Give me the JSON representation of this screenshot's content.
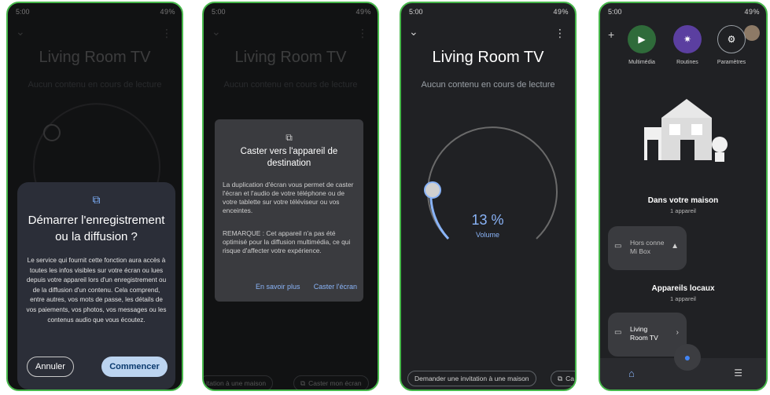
{
  "status": {
    "time": "5:00",
    "icons_left": "⋮ ⁝ ⌚",
    "battery": "49%",
    "signal": "✕ ≋ .ıl .ıl"
  },
  "device_title": "Living Room TV",
  "no_content": "Aucun contenu en cours de lecture",
  "icons": {
    "chevron": "⌄",
    "more": "⋮",
    "cast": "⧉",
    "plus": "+",
    "home": "⌂",
    "list": "☰",
    "mic": "🎤"
  },
  "screen1": {
    "dialog_title_line1": "Démarrer l'enregistrement",
    "dialog_title_line2": "ou la diffusion ?",
    "dialog_body": "Le service qui fournit cette fonction aura accès à toutes les infos visibles sur votre écran ou lues depuis votre appareil lors d'un enregistrement ou de la diffusion d'un contenu. Cela comprend, entre autres, vos mots de passe, les détails de vos paiements, vos photos, vos messages ou les contenus audio que vous écoutez.",
    "cancel_label": "Annuler",
    "start_label": "Commencer"
  },
  "screen2": {
    "dialog_title": "Caster vers l'appareil de destination",
    "para1": "La duplication d'écran vous permet de caster l'écran et l'audio de votre téléphone ou de votre tablette sur votre téléviseur ou vos enceintes.",
    "para2": "REMARQUE : Cet appareil n'a pas été optimisé pour la diffusion multimédia, ce qui risque d'affecter votre expérience.",
    "learn_more": "En savoir plus",
    "cast_screen": "Caster l'écran",
    "chip_invite": "itation à une maison",
    "chip_cast": "Caster mon écran"
  },
  "screen3": {
    "volume_percent": "13 %",
    "volume_label": "Volume",
    "volume_level": 0.13,
    "chip_invite": "Demander une invitation à une maison",
    "chip_cast": "Ca"
  },
  "screen4": {
    "quick_actions": [
      "Multimédia",
      "Routines",
      "Paramètres"
    ],
    "section_home": "Dans votre maison",
    "section_home_count": "1 appareil",
    "device_offline_line1": "Hors conne",
    "device_offline_line2": "Mi Box",
    "section_local": "Appareils locaux",
    "section_local_count": "1 appareil",
    "device_local_line1": "Living",
    "device_local_line2": "Room TV"
  }
}
